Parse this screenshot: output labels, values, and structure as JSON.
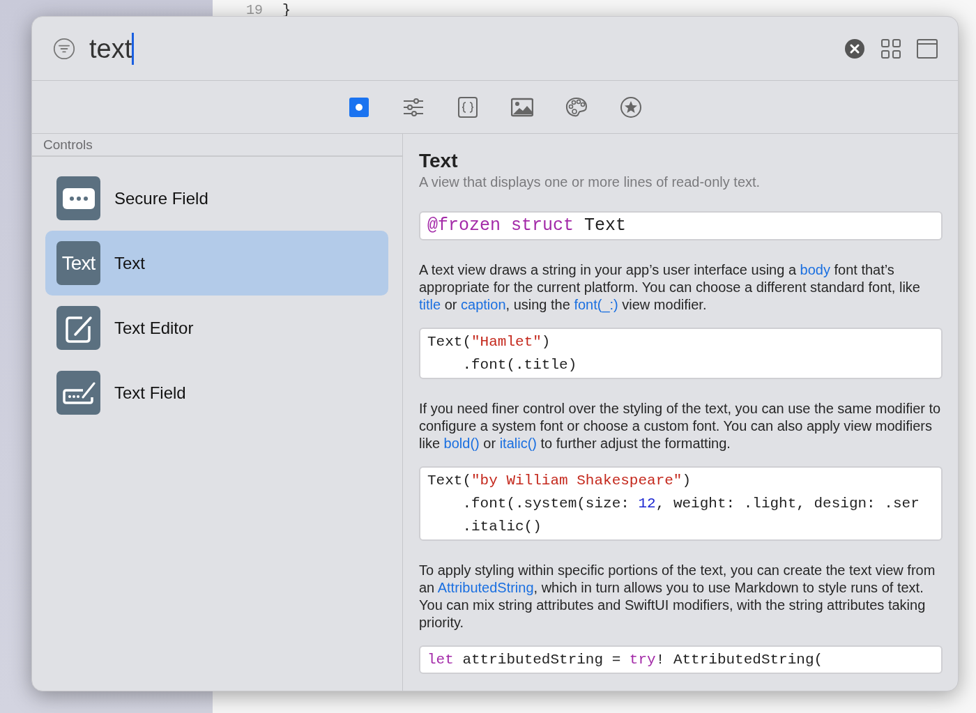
{
  "editor": {
    "line_number": "19",
    "line_text": "}"
  },
  "search": {
    "value": "text"
  },
  "tabs": [
    {
      "selected": true
    },
    {
      "selected": false
    },
    {
      "selected": false
    },
    {
      "selected": false
    },
    {
      "selected": false
    },
    {
      "selected": false
    }
  ],
  "sidebar": {
    "header": "Controls",
    "items": [
      {
        "label": "Secure Field",
        "kind": "secure",
        "selected": false
      },
      {
        "label": "Text",
        "kind": "text",
        "icon_text": "Text",
        "selected": true
      },
      {
        "label": "Text Editor",
        "kind": "editor",
        "selected": false
      },
      {
        "label": "Text Field",
        "kind": "field",
        "selected": false
      }
    ]
  },
  "detail": {
    "title": "Text",
    "subtitle": "A view that displays one or more lines of read-only text.",
    "blocks": [
      {
        "kind": "code",
        "lines": [
          [
            {
              "kind": "keyword",
              "text": "@frozen struct"
            },
            {
              "kind": "plain",
              "text": " Text"
            }
          ]
        ]
      },
      {
        "kind": "paragraph",
        "segments": [
          {
            "kind": "plain",
            "text": "A text view draws a string in your app’s user interface using a "
          },
          {
            "kind": "link",
            "text": "body"
          },
          {
            "kind": "plain",
            "text": " font that’s appropriate for the current platform. You can choose a different standard font, like "
          },
          {
            "kind": "link",
            "text": "title"
          },
          {
            "kind": "plain",
            "text": " or "
          },
          {
            "kind": "link",
            "text": "caption"
          },
          {
            "kind": "plain",
            "text": ", using the "
          },
          {
            "kind": "link",
            "text": "font(_:)"
          },
          {
            "kind": "plain",
            "text": " view modifier."
          }
        ]
      },
      {
        "kind": "code",
        "lines": [
          [
            {
              "kind": "plain",
              "text": "Text("
            },
            {
              "kind": "string",
              "text": "\"Hamlet\""
            },
            {
              "kind": "plain",
              "text": ")"
            }
          ],
          [
            {
              "kind": "plain",
              "text": "    .font(.title)"
            }
          ]
        ]
      },
      {
        "kind": "paragraph",
        "segments": [
          {
            "kind": "plain",
            "text": "If you need finer control over the styling of the text, you can use the same modifier to configure a system font or choose a custom font. You can also apply view modifiers like "
          },
          {
            "kind": "link",
            "text": "bold()"
          },
          {
            "kind": "plain",
            "text": " or "
          },
          {
            "kind": "link",
            "text": "italic()"
          },
          {
            "kind": "plain",
            "text": " to further adjust the formatting."
          }
        ]
      },
      {
        "kind": "code",
        "lines": [
          [
            {
              "kind": "plain",
              "text": "Text("
            },
            {
              "kind": "string",
              "text": "\"by William Shakespeare\""
            },
            {
              "kind": "plain",
              "text": ")"
            }
          ],
          [
            {
              "kind": "plain",
              "text": "    .font(.system(size: "
            },
            {
              "kind": "number",
              "text": "12"
            },
            {
              "kind": "plain",
              "text": ", weight: .light, design: .ser"
            }
          ],
          [
            {
              "kind": "plain",
              "text": "    .italic()"
            }
          ]
        ]
      },
      {
        "kind": "paragraph",
        "segments": [
          {
            "kind": "plain",
            "text": "To apply styling within specific portions of the text, you can create the text view from an "
          },
          {
            "kind": "link",
            "text": "AttributedString"
          },
          {
            "kind": "plain",
            "text": ", which in turn allows you to use Markdown to style runs of text. You can mix string attributes and SwiftUI modifiers, with the string attributes taking priority."
          }
        ]
      },
      {
        "kind": "code",
        "lines": [
          [
            {
              "kind": "keyword",
              "text": "let"
            },
            {
              "kind": "plain",
              "text": " attributedString = "
            },
            {
              "kind": "keyword",
              "text": "try"
            },
            {
              "kind": "plain",
              "text": "! AttributedString("
            }
          ]
        ]
      }
    ]
  }
}
